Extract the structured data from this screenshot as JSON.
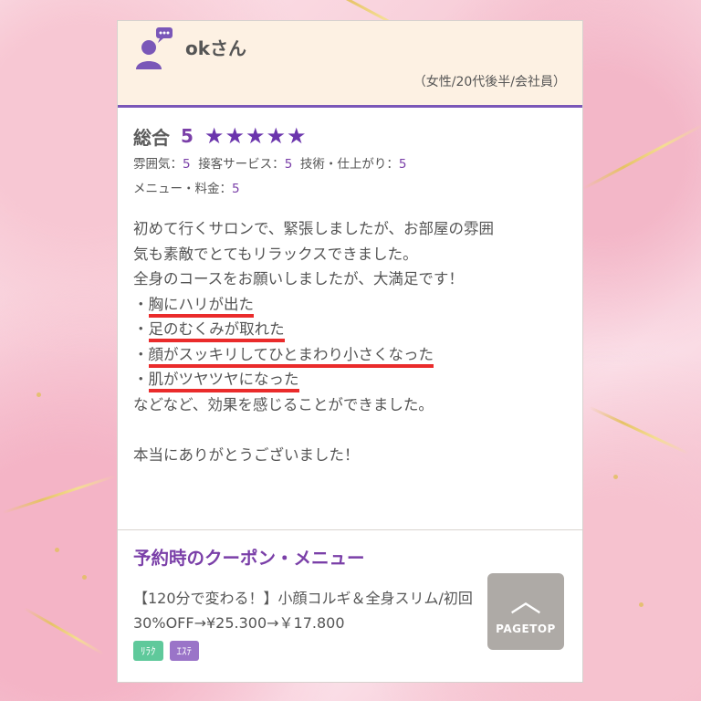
{
  "review": {
    "nickname": "okさん",
    "profile": "（女性/20代後半/会社員）",
    "overall_label": "総合",
    "overall_score": "5",
    "stars": "★★★★★",
    "ratings": {
      "atmosphere_label": "雰囲気：",
      "atmosphere_value": "5",
      "service_label": "接客サービス：",
      "service_value": "5",
      "technique_label": "技術・仕上がり：",
      "technique_value": "5",
      "menu_label": "メニュー・料金：",
      "menu_value": "5"
    },
    "body_lines": [
      "初めて行くサロンで、緊張しましたが、お部屋の雰囲",
      "気も素敵でとてもリラックスできました。",
      "全身のコースをお願いしましたが、大満足です！"
    ],
    "bullets": [
      {
        "dot": "・",
        "text": "胸にハリが出た"
      },
      {
        "dot": "・",
        "text": "足のむくみが取れた"
      },
      {
        "dot": "・",
        "text": "顔がスッキリしてひとまわり小さくなった"
      },
      {
        "dot": "・",
        "text": "肌がツヤツヤになった"
      }
    ],
    "after_bullets": "などなど、効果を感じることができました。",
    "closing": "本当にありがとうございました！"
  },
  "coupon": {
    "heading": "予約時のクーポン・メニュー",
    "description": "【120分で変わる！】小顔コルギ＆全身スリム/初回",
    "price": "30%OFF→¥25.300→￥17.800",
    "tags": [
      "ﾘﾗｸ",
      "ｴｽﾃ"
    ]
  },
  "pagetop": {
    "chevron": "︿",
    "label": "PAGETOP"
  },
  "colors": {
    "accent": "#7a3fa8",
    "underline": "#ea2b2b",
    "header_bg": "#fdf1e3"
  }
}
